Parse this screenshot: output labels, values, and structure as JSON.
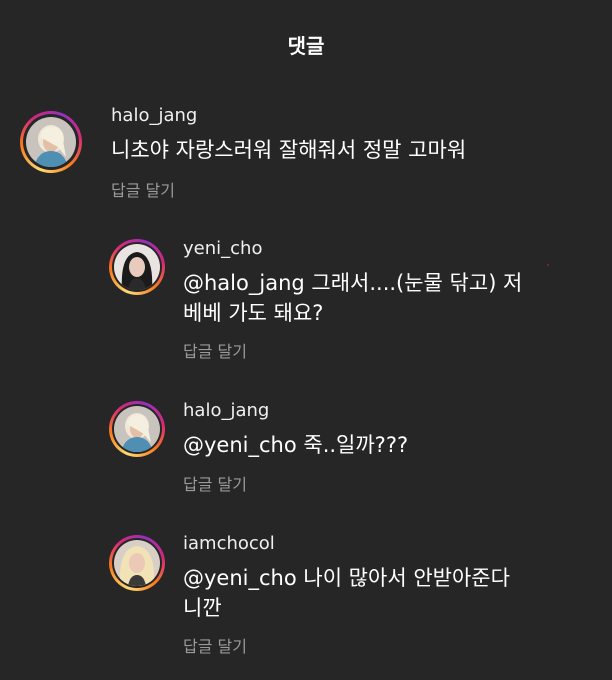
{
  "header": {
    "title": "댓글"
  },
  "reply_label": "답글 달기",
  "comments": [
    {
      "username": "halo_jang",
      "text": "니초야 자랑스러워 잘해줘서 정말 고마워",
      "avatar": "platinum-hair-profile-photo"
    },
    {
      "username": "yeni_cho",
      "text": "@halo_jang 그래서....(눈물 닦고) 저 베베 가도 돼요?",
      "avatar": "dark-hair-profile-photo"
    },
    {
      "username": "halo_jang",
      "text": "@yeni_cho 죽..일까???",
      "avatar": "platinum-hair-profile-photo"
    },
    {
      "username": "iamchocol",
      "text": "@yeni_cho 나이 많아서 안받아준다니깐",
      "avatar": "blonde-hair-profile-photo"
    }
  ]
}
